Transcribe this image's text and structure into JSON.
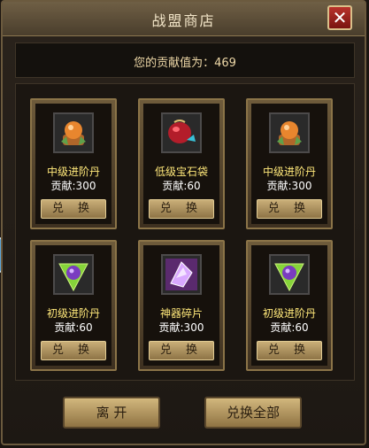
{
  "window": {
    "title": "战盟商店",
    "close_label": "✕"
  },
  "contribution": {
    "text": "您的贡献值为：469"
  },
  "items": [
    {
      "name": "中级进阶丹",
      "cost": "贡献:300",
      "button": "兑 换",
      "icon": "ornate-orange-orb-icon"
    },
    {
      "name": "低级宝石袋",
      "cost": "贡献:60",
      "button": "兑 换",
      "icon": "red-gem-bag-icon"
    },
    {
      "name": "中级进阶丹",
      "cost": "贡献:300",
      "button": "兑 换",
      "icon": "ornate-orange-orb-icon"
    },
    {
      "name": "初级进阶丹",
      "cost": "贡献:60",
      "button": "兑 换",
      "icon": "purple-orb-leaf-icon"
    },
    {
      "name": "神器碎片",
      "cost": "贡献:300",
      "button": "兑 换",
      "icon": "artifact-shard-icon"
    },
    {
      "name": "初级进阶丹",
      "cost": "贡献:60",
      "button": "兑 换",
      "icon": "purple-orb-leaf-icon"
    }
  ],
  "footer": {
    "leave_label": "离 开",
    "exchange_all_label": "兑换全部"
  }
}
